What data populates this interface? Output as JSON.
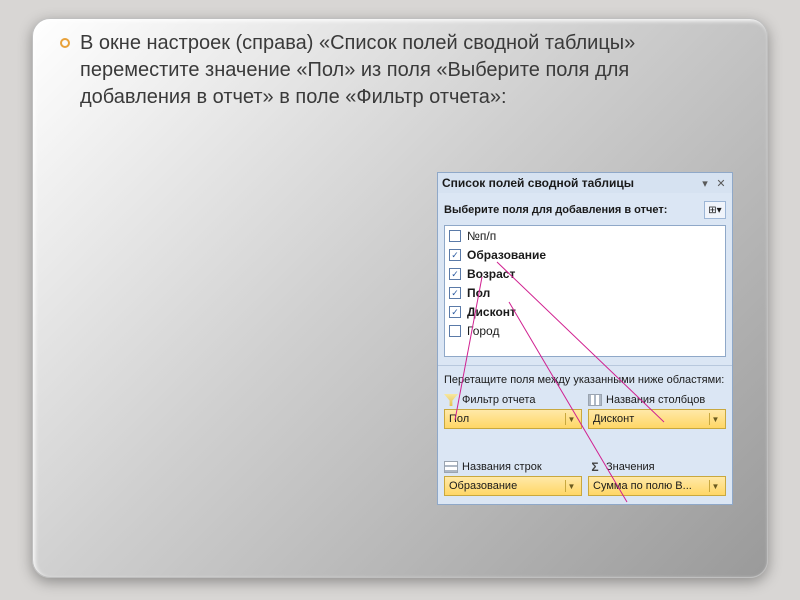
{
  "instruction": "В окне настроек (справа) «Список полей сводной таблицы» переместите значение «Пол» из поля «Выберите поля для добавления в отчет» в поле «Фильтр отчета»:",
  "panel": {
    "title": "Список полей сводной таблицы",
    "chooseLabel": "Выберите поля для добавления в отчет:",
    "dragLabel": "Перетащите поля между указанными ниже областями:",
    "fields": [
      {
        "name": "№п/п",
        "checked": false,
        "bold": false
      },
      {
        "name": "Образование",
        "checked": true,
        "bold": true
      },
      {
        "name": "Возраст",
        "checked": true,
        "bold": true
      },
      {
        "name": "Пол",
        "checked": true,
        "bold": true
      },
      {
        "name": "Дисконт",
        "checked": true,
        "bold": true
      },
      {
        "name": "Город",
        "checked": false,
        "bold": false
      }
    ],
    "areas": {
      "filter": {
        "label": "Фильтр отчета",
        "value": "Пол"
      },
      "columns": {
        "label": "Названия столбцов",
        "value": "Дисконт"
      },
      "rows": {
        "label": "Названия строк",
        "value": "Образование"
      },
      "values": {
        "label": "Значения",
        "value": "Сумма по полю В..."
      }
    }
  }
}
